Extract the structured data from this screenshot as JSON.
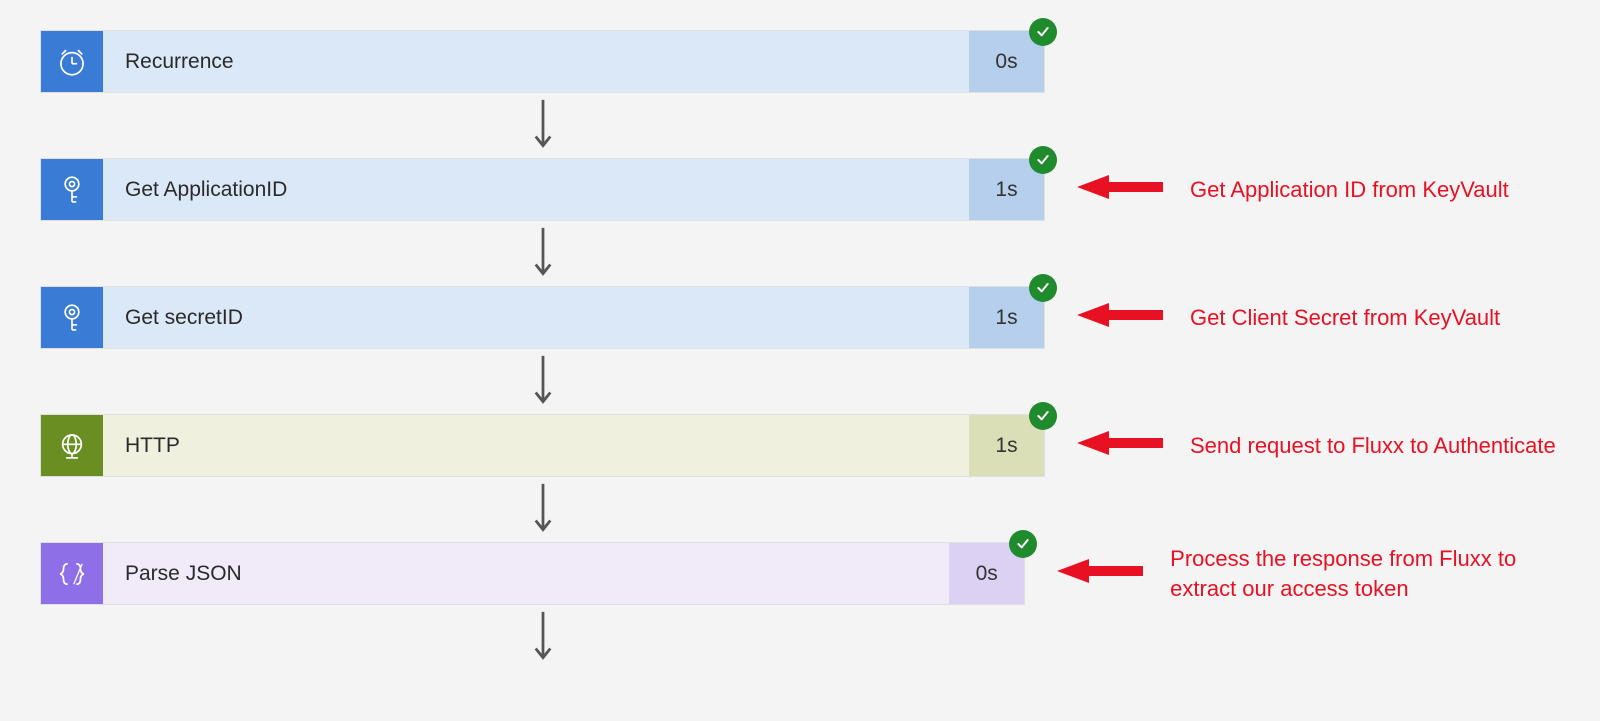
{
  "flow": {
    "nodes": [
      {
        "id": "recurrence",
        "title": "Recurrence",
        "duration": "0s",
        "theme": "blue",
        "icon": "clock",
        "annotation": null
      },
      {
        "id": "get-applicationid",
        "title": "Get ApplicationID",
        "duration": "1s",
        "theme": "blue",
        "icon": "keyvault",
        "annotation": "Get Application ID from KeyVault"
      },
      {
        "id": "get-secretid",
        "title": "Get secretID",
        "duration": "1s",
        "theme": "blue",
        "icon": "keyvault",
        "annotation": "Get Client Secret from KeyVault"
      },
      {
        "id": "http",
        "title": "HTTP",
        "duration": "1s",
        "theme": "green",
        "icon": "globe",
        "annotation": "Send request to Fluxx to Authenticate"
      },
      {
        "id": "parse-json",
        "title": "Parse JSON",
        "duration": "0s",
        "theme": "purple",
        "icon": "json",
        "annotation": "Process the response from Fluxx to extract our access token"
      }
    ]
  },
  "icons": {
    "clock": "clock-icon",
    "keyvault": "keyvault-icon",
    "globe": "globe-icon",
    "json": "json-icon"
  },
  "status": {
    "success_color": "#1f8b2c"
  }
}
